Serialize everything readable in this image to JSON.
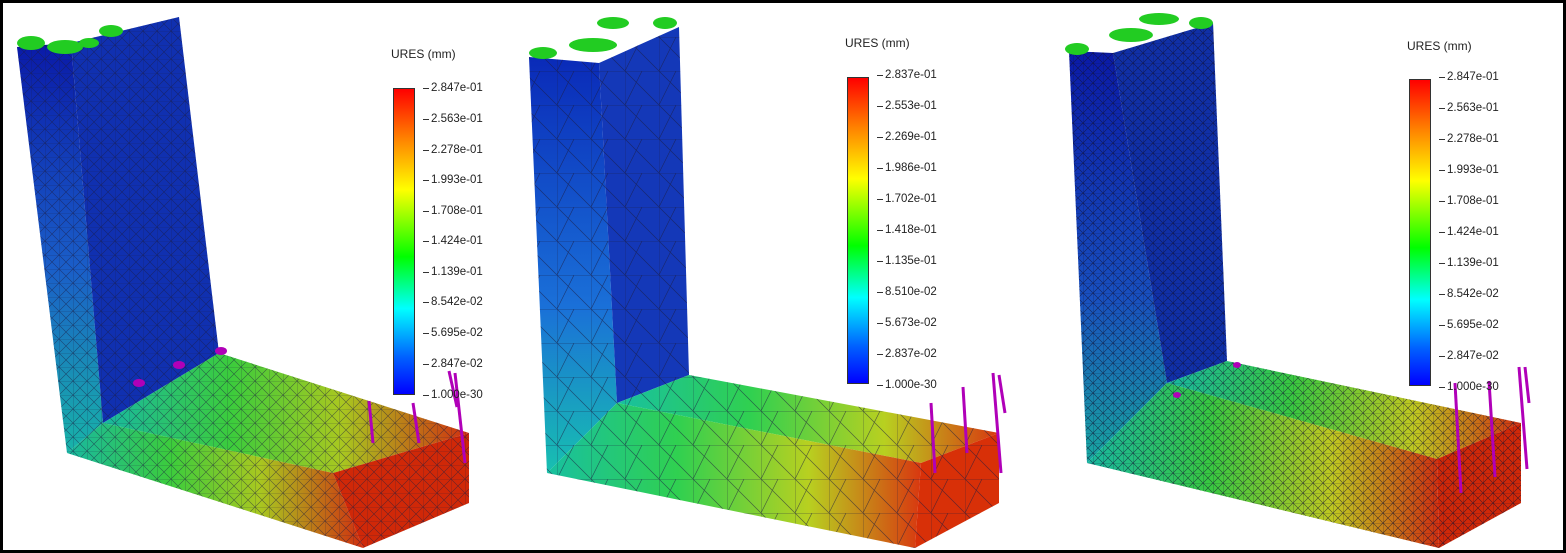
{
  "panels": [
    {
      "legend_title": "URES (mm)",
      "ticks": [
        "2.847e-01",
        "2.563e-01",
        "2.278e-01",
        "1.993e-01",
        "1.708e-01",
        "1.424e-01",
        "1.139e-01",
        "8.542e-02",
        "5.695e-02",
        "2.847e-02",
        "1.000e-30"
      ]
    },
    {
      "legend_title": "URES (mm)",
      "ticks": [
        "2.837e-01",
        "2.553e-01",
        "2.269e-01",
        "1.986e-01",
        "1.702e-01",
        "1.418e-01",
        "1.135e-01",
        "8.510e-02",
        "5.673e-02",
        "2.837e-02",
        "1.000e-30"
      ]
    },
    {
      "legend_title": "URES (mm)",
      "ticks": [
        "2.847e-01",
        "2.563e-01",
        "2.278e-01",
        "1.993e-01",
        "1.708e-01",
        "1.424e-01",
        "1.139e-01",
        "8.542e-02",
        "5.695e-02",
        "2.847e-02",
        "1.000e-30"
      ]
    }
  ],
  "colors": {
    "fixture_arrows": "#22cc22",
    "load_arrows": "#b000b8",
    "mesh_lines": "#1a1a40"
  }
}
